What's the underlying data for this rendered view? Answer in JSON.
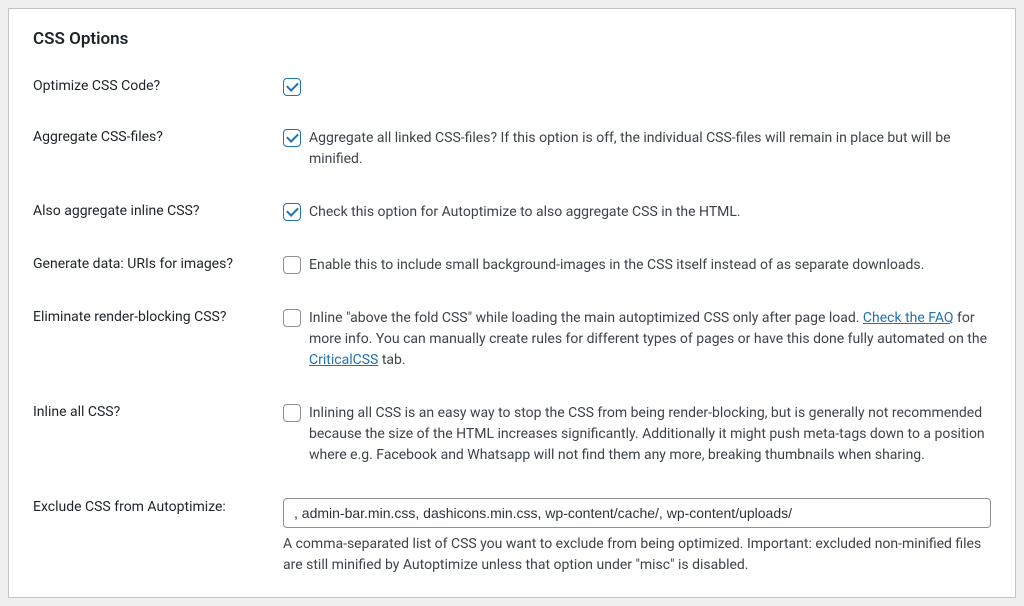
{
  "panel": {
    "title": "CSS Options"
  },
  "rows": {
    "optimize": {
      "label": "Optimize CSS Code?",
      "checked": true
    },
    "aggregate": {
      "label": "Aggregate CSS-files?",
      "checked": true,
      "desc": "Aggregate all linked CSS-files? If this option is off, the individual CSS-files will remain in place but will be minified."
    },
    "inlineAgg": {
      "label": "Also aggregate inline CSS?",
      "checked": true,
      "desc": "Check this option for Autoptimize to also aggregate CSS in the HTML."
    },
    "datauri": {
      "label": "Generate data: URIs for images?",
      "checked": false,
      "desc": "Enable this to include small background-images in the CSS itself instead of as separate downloads."
    },
    "renderblock": {
      "label": "Eliminate render-blocking CSS?",
      "checked": false,
      "descParts": {
        "a": "Inline \"above the fold CSS\" while loading the main autoptimized CSS only after page load. ",
        "link1": "Check the FAQ",
        "b": " for more info. You can manually create rules for different types of pages or have this done fully automated on the ",
        "link2": "CriticalCSS",
        "c": " tab."
      }
    },
    "inlineall": {
      "label": "Inline all CSS?",
      "checked": false,
      "desc": "Inlining all CSS is an easy way to stop the CSS from being render-blocking, but is generally not recommended because the size of the HTML increases significantly. Additionally it might push meta-tags down to a position where e.g. Facebook and Whatsapp will not find them any more, breaking thumbnails when sharing."
    },
    "exclude": {
      "label": "Exclude CSS from Autoptimize:",
      "value": ", admin-bar.min.css, dashicons.min.css, wp-content/cache/, wp-content/uploads/",
      "help": "A comma-separated list of CSS you want to exclude from being optimized. Important: excluded non-minified files are still minified by Autoptimize unless that option under \"misc\" is disabled."
    }
  }
}
